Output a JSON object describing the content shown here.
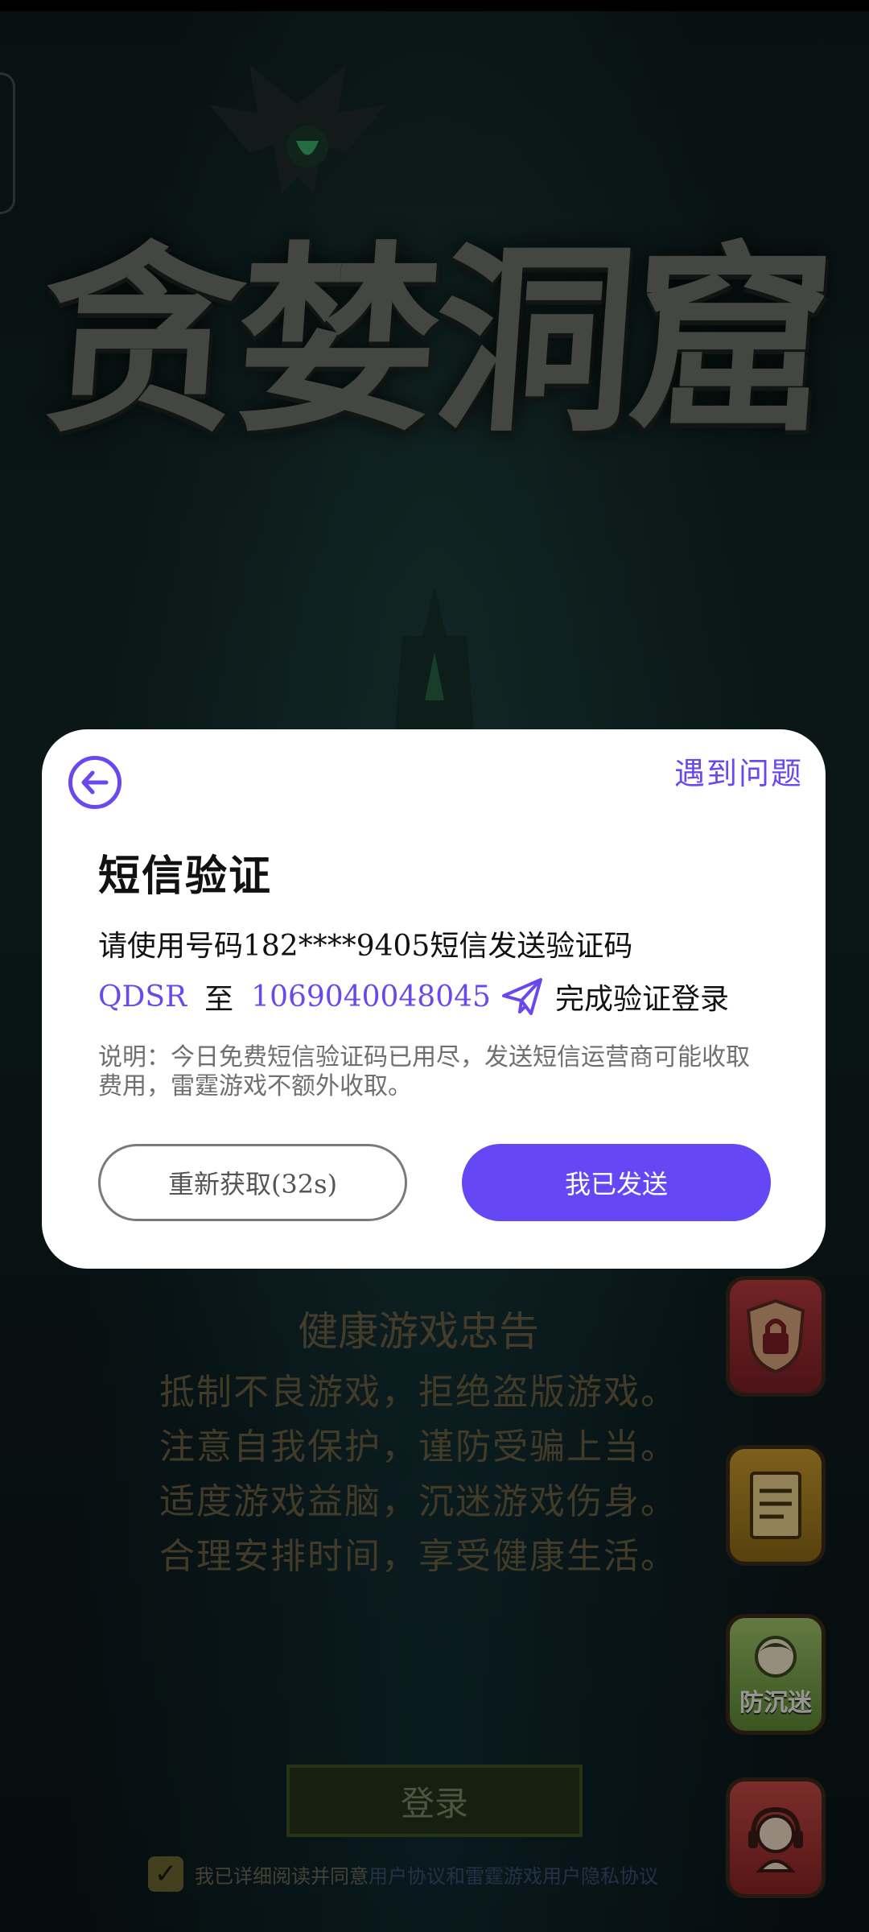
{
  "game": {
    "title": "贪婪洞窟"
  },
  "health_notice": {
    "title": "健康游戏忠告",
    "lines": [
      "抵制不良游戏，拒绝盗版游戏。",
      "注意自我保护，谨防受骗上当。",
      "适度游戏益脑，沉迷游戏伤身。",
      "合理安排时间，享受健康生活。"
    ]
  },
  "side_buttons": {
    "anti_addiction_label": "防沉迷"
  },
  "login": {
    "button_label": "登录",
    "agree_text": "我已详细阅读并同意",
    "agree_links": "用户协议和雷霆游戏用户隐私协议"
  },
  "dialog": {
    "help_label": "遇到问题",
    "title": "短信验证",
    "instruction": "请使用号码182****9405短信发送验证码",
    "code": "QDSR",
    "to_word": "至",
    "target_number": "1069040048045",
    "complete_text": "完成验证登录",
    "note": "说明：今日免费短信验证码已用尽，发送短信运营商可能收取费用，雷霆游戏不额外收取。",
    "resend_label": "重新获取(32s)",
    "sent_label": "我已发送"
  },
  "colors": {
    "accent": "#6547f5",
    "link": "#6a48ee"
  }
}
